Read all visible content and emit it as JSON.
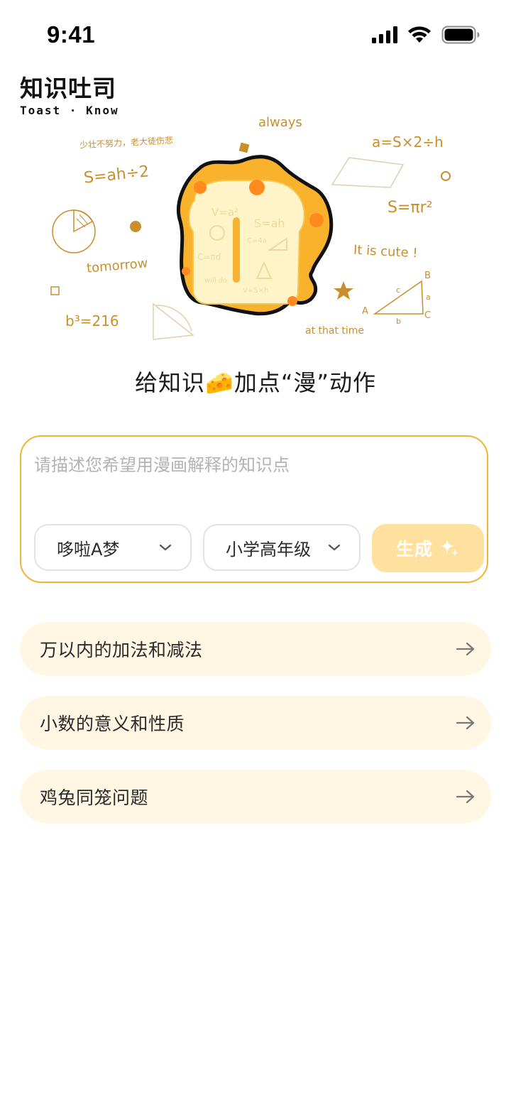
{
  "status_bar": {
    "time": "9:41",
    "icons": [
      "cellular-signal-icon",
      "wifi-icon",
      "battery-icon"
    ]
  },
  "brand": {
    "name_zh": "知识吐司",
    "name_en": "Toast · Know"
  },
  "hero": {
    "doodles": [
      "always",
      "a=S×2÷h",
      "少壮不努力，老大徒伤悲",
      "S=ah÷2",
      "S=πr²",
      "tomorrow",
      "It is cute !",
      "b³=216",
      "at that time"
    ],
    "icon": "toast-mascot-illustration"
  },
  "tagline": "给知识🧀加点“漫”动作",
  "prompt": {
    "placeholder": "请描述您希望用漫画解释的知识点",
    "value": "",
    "character_select": "哆啦A梦",
    "grade_select": "小学高年级",
    "generate_label": "生成"
  },
  "suggestions": [
    {
      "label": "万以内的加法和减法"
    },
    {
      "label": "小数的意义和性质"
    },
    {
      "label": "鸡兔同笼问题"
    }
  ],
  "colors": {
    "accent": "#f1b531",
    "generate_bg": "#ffe19f",
    "suggestion_bg": "#fff7e3",
    "doodle": "#c98f2d",
    "toast_crust": "#f9b22c",
    "toast_spot": "#ff8a1f"
  }
}
